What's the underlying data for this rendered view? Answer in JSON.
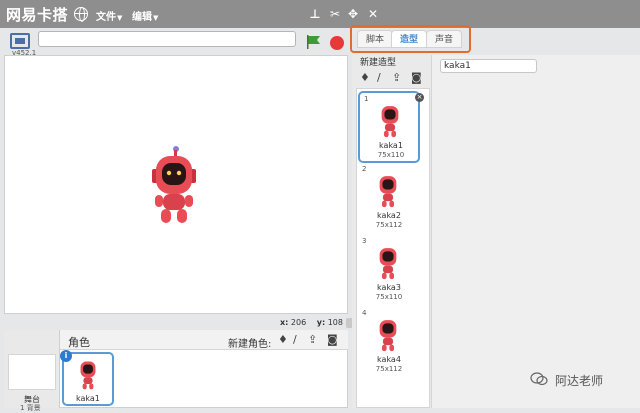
{
  "app": {
    "title": "网易卡搭",
    "version": "v452.1"
  },
  "menu": {
    "file_label": "文件",
    "edit_label": "编辑"
  },
  "project": {
    "name_value": ""
  },
  "stage": {
    "coords": {
      "x_label": "x:",
      "x_value": "206",
      "y_label": "y:",
      "y_value": "108"
    }
  },
  "sprites": {
    "title": "角色",
    "new_sprite_label": "新建角色:",
    "stage_label": "舞台",
    "stage_sub": "1 背景",
    "items": [
      {
        "name": "kaka1"
      }
    ]
  },
  "tabs": [
    {
      "label": "脚本",
      "active": false
    },
    {
      "label": "造型",
      "active": true
    },
    {
      "label": "声音",
      "active": false
    }
  ],
  "costumes": {
    "new_costume_label": "新建造型",
    "selected_name_value": "kaka1",
    "items": [
      {
        "number": "1",
        "name": "kaka1",
        "size": "75x110"
      },
      {
        "number": "2",
        "name": "kaka2",
        "size": "75x112"
      },
      {
        "number": "3",
        "name": "kaka3",
        "size": "75x110"
      },
      {
        "number": "4",
        "name": "kaka4",
        "size": "75x112"
      }
    ]
  },
  "watermark": {
    "text": "阿达老师"
  },
  "colors": {
    "accent": "#3d8ad6",
    "highlight": "#e06c2f",
    "stop": "#e8393a",
    "robot": "#e84c55"
  }
}
